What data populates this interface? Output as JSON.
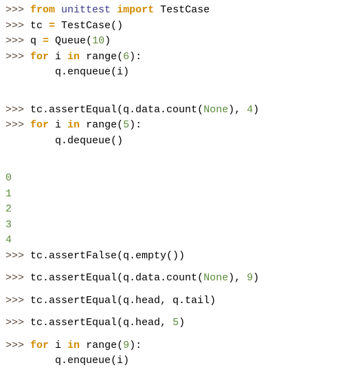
{
  "prompt": ">>> ",
  "indent": "        ",
  "lines": {
    "l1": {
      "kw1": "from",
      "mod": "unittest",
      "kw2": "import",
      "cls": "TestCase"
    },
    "l2": {
      "pre": "tc ",
      "op": "=",
      "post": " TestCase()"
    },
    "l3": {
      "pre": "q ",
      "op": "=",
      "post": " Queue(",
      "n": "10",
      "close": ")"
    },
    "l4": {
      "kw": "for",
      "var": " i ",
      "kw2": "in",
      "fn": " range(",
      "n": "6",
      "close": "):"
    },
    "l5": {
      "body": "q.enqueue(i)"
    },
    "l6": {
      "pre": "tc.assertEqual(q.data.count(",
      "none": "None",
      "post": "), ",
      "n": "4",
      "close": ")"
    },
    "l7": {
      "kw": "for",
      "var": " i ",
      "kw2": "in",
      "fn": " range(",
      "n": "5",
      "close": "):"
    },
    "l8": {
      "body": "q.dequeue()"
    },
    "out": [
      "0",
      "1",
      "2",
      "3",
      "4"
    ],
    "l9": {
      "text": "tc.assertFalse(q.empty())"
    },
    "l10": {
      "pre": "tc.assertEqual(q.data.count(",
      "none": "None",
      "post": "), ",
      "n": "9",
      "close": ")"
    },
    "l11": {
      "text": "tc.assertEqual(q.head, q.tail)"
    },
    "l12": {
      "pre": "tc.assertEqual(q.head, ",
      "n": "5",
      "close": ")"
    },
    "l13": {
      "kw": "for",
      "var": " i ",
      "kw2": "in",
      "fn": " range(",
      "n": "9",
      "close": "):"
    },
    "l14": {
      "body": "q.enqueue(i)"
    }
  }
}
